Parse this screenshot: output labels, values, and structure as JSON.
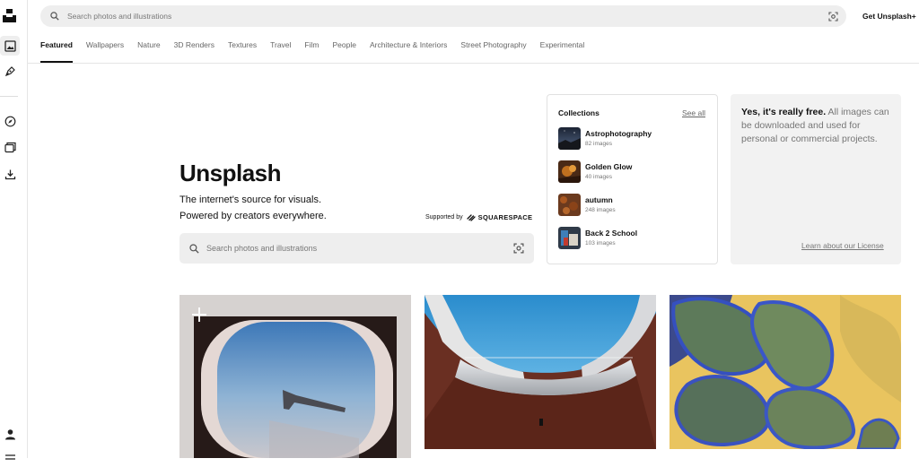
{
  "rail": {
    "items": [
      "logo",
      "photos-icon",
      "illustrations-icon",
      "explore-icon",
      "collections-icon",
      "downloads-icon",
      "user-icon",
      "more-icon"
    ]
  },
  "header": {
    "search_placeholder": "Search photos and illustrations",
    "get_plus": "Get Unsplash+"
  },
  "tabs": [
    {
      "label": "Featured",
      "active": true
    },
    {
      "label": "Wallpapers"
    },
    {
      "label": "Nature"
    },
    {
      "label": "3D Renders"
    },
    {
      "label": "Textures"
    },
    {
      "label": "Travel"
    },
    {
      "label": "Film"
    },
    {
      "label": "People"
    },
    {
      "label": "Architecture & Interiors"
    },
    {
      "label": "Street Photography"
    },
    {
      "label": "Experimental"
    }
  ],
  "hero": {
    "title": "Unsplash",
    "subtitle_line1": "The internet's source for visuals.",
    "subtitle_line2": "Powered by creators everywhere.",
    "supported_by": "Supported by",
    "sponsor": "SQUARESPACE",
    "search_placeholder": "Search photos and illustrations"
  },
  "collections": {
    "heading": "Collections",
    "see_all": "See all",
    "items": [
      {
        "name": "Astrophotography",
        "count": "82 images"
      },
      {
        "name": "Golden Glow",
        "count": "40 images"
      },
      {
        "name": "autumn",
        "count": "248 images"
      },
      {
        "name": "Back 2 School",
        "count": "103 images"
      }
    ]
  },
  "free": {
    "bold": "Yes, it's really free.",
    "rest": " All images can be downloaded and used for personal or commercial projects.",
    "license": "Learn about our License"
  },
  "photos": [
    "airplane-window-photo",
    "architecture-balcony-photo",
    "abstract-3d-render-photo"
  ],
  "colors": {
    "accent": "#111111",
    "muted": "#767676",
    "search_bg": "#eeeeee"
  }
}
